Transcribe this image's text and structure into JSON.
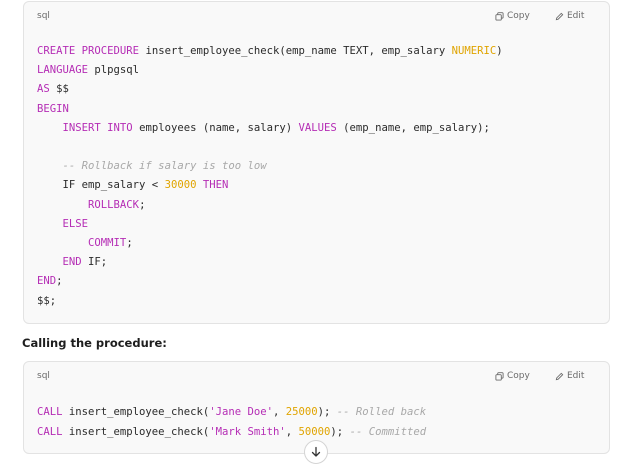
{
  "block1": {
    "language": "sql",
    "copy_label": "Copy",
    "edit_label": "Edit",
    "lines": [
      [
        [
          "kw",
          "CREATE PROCEDURE"
        ],
        [
          "tx",
          " insert_employee_check(emp_name TEXT, emp_salary "
        ],
        [
          "nm",
          "NUMERIC"
        ],
        [
          "tx",
          ")"
        ]
      ],
      [
        [
          "kw",
          "LANGUAGE"
        ],
        [
          "tx",
          " plpgsql"
        ]
      ],
      [
        [
          "kw",
          "AS"
        ],
        [
          "tx",
          " $$"
        ]
      ],
      [
        [
          "kw",
          "BEGIN"
        ]
      ],
      [
        [
          "tx",
          "    "
        ],
        [
          "kw",
          "INSERT INTO"
        ],
        [
          "tx",
          " employees (name, salary) "
        ],
        [
          "kw",
          "VALUES"
        ],
        [
          "tx",
          " (emp_name, emp_salary);"
        ]
      ],
      [
        [
          "tx",
          ""
        ]
      ],
      [
        [
          "tx",
          "    "
        ],
        [
          "cm",
          "-- Rollback if salary is too low"
        ]
      ],
      [
        [
          "tx",
          "    IF emp_salary < "
        ],
        [
          "nm",
          "30000"
        ],
        [
          "tx",
          " "
        ],
        [
          "kw",
          "THEN"
        ]
      ],
      [
        [
          "tx",
          "        "
        ],
        [
          "kw",
          "ROLLBACK"
        ],
        [
          "tx",
          ";"
        ]
      ],
      [
        [
          "tx",
          "    "
        ],
        [
          "kw",
          "ELSE"
        ]
      ],
      [
        [
          "tx",
          "        "
        ],
        [
          "kw",
          "COMMIT"
        ],
        [
          "tx",
          ";"
        ]
      ],
      [
        [
          "tx",
          "    "
        ],
        [
          "kw",
          "END"
        ],
        [
          "tx",
          " IF;"
        ]
      ],
      [
        [
          "kw",
          "END"
        ],
        [
          "tx",
          ";"
        ]
      ],
      [
        [
          "tx",
          "$$;"
        ]
      ]
    ]
  },
  "section_title": "Calling the procedure:",
  "block2": {
    "language": "sql",
    "copy_label": "Copy",
    "edit_label": "Edit",
    "lines": [
      [
        [
          "kw",
          "CALL"
        ],
        [
          "tx",
          " insert_employee_check("
        ],
        [
          "st",
          "'Jane Doe'"
        ],
        [
          "tx",
          ", "
        ],
        [
          "nm",
          "25000"
        ],
        [
          "tx",
          "); "
        ],
        [
          "cm",
          "-- Rolled back"
        ]
      ],
      [
        [
          "kw",
          "CALL"
        ],
        [
          "tx",
          " insert_employee_check("
        ],
        [
          "st",
          "'Mark Smith'"
        ],
        [
          "tx",
          ", "
        ],
        [
          "nm",
          "50000"
        ],
        [
          "tx",
          "); "
        ],
        [
          "cm",
          "-- Committed"
        ]
      ]
    ]
  },
  "colors": {
    "keyword": "#b52db5",
    "number": "#e0a400",
    "comment": "#a8a8a8",
    "text": "#2b2b2b"
  },
  "icons": {
    "copy": "copy-icon",
    "edit": "edit-icon",
    "scroll_down": "arrow-down-icon"
  }
}
